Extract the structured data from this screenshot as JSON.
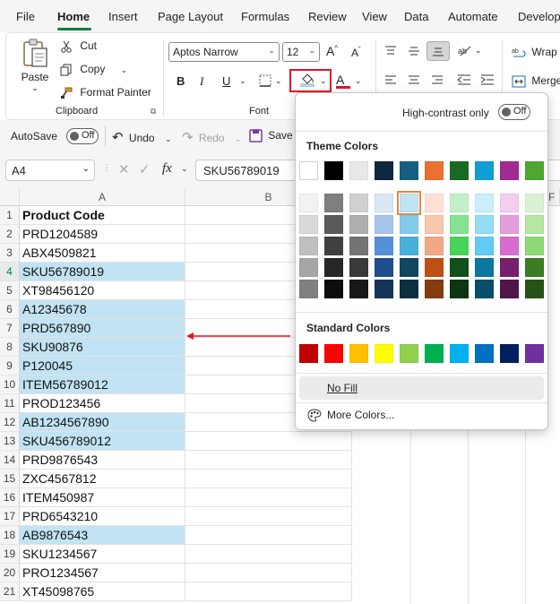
{
  "menu": {
    "tabs": [
      {
        "label": "File"
      },
      {
        "label": "Home"
      },
      {
        "label": "Insert"
      },
      {
        "label": "Page Layout"
      },
      {
        "label": "Formulas"
      },
      {
        "label": "Review"
      },
      {
        "label": "View"
      },
      {
        "label": "Data"
      },
      {
        "label": "Automate"
      },
      {
        "label": "Develop"
      }
    ],
    "active": "Home"
  },
  "ribbon": {
    "clipboard": {
      "paste": "Paste",
      "cut": "Cut",
      "copy": "Copy",
      "format_painter": "Format Painter",
      "label": "Clipboard"
    },
    "font": {
      "name": "Aptos Narrow",
      "size": "12",
      "bold": "B",
      "italic": "I",
      "underline": "U",
      "font_color_letter": "A",
      "label": "Font"
    },
    "alignment": {
      "wrap": "Wrap T",
      "merge": "Merge"
    }
  },
  "qat": {
    "autosave": "AutoSave",
    "autosave_state": "Off",
    "undo": "Undo",
    "redo": "Redo",
    "save": "Save"
  },
  "formula_bar": {
    "name_box": "A4",
    "fx": "fx",
    "value": "SKU56789019"
  },
  "grid": {
    "columns": [
      "A",
      "B",
      "F"
    ],
    "rows": [
      {
        "n": "1",
        "value": "Product Code",
        "highlight": false
      },
      {
        "n": "2",
        "value": "PRD1204589",
        "highlight": false
      },
      {
        "n": "3",
        "value": "ABX4509821",
        "highlight": false
      },
      {
        "n": "4",
        "value": "SKU56789019",
        "highlight": true
      },
      {
        "n": "5",
        "value": "XT98456120",
        "highlight": false
      },
      {
        "n": "6",
        "value": "A12345678",
        "highlight": true
      },
      {
        "n": "7",
        "value": "PRD567890",
        "highlight": true
      },
      {
        "n": "8",
        "value": "SKU90876",
        "highlight": true
      },
      {
        "n": "9",
        "value": "P120045",
        "highlight": true
      },
      {
        "n": "10",
        "value": "ITEM56789012",
        "highlight": true
      },
      {
        "n": "11",
        "value": "PROD123456",
        "highlight": false
      },
      {
        "n": "12",
        "value": "AB1234567890",
        "highlight": true
      },
      {
        "n": "13",
        "value": "SKU456789012",
        "highlight": true
      },
      {
        "n": "14",
        "value": "PRD9876543",
        "highlight": false
      },
      {
        "n": "15",
        "value": "ZXC4567812",
        "highlight": false
      },
      {
        "n": "16",
        "value": "ITEM450987",
        "highlight": false
      },
      {
        "n": "17",
        "value": "PRD6543210",
        "highlight": false
      },
      {
        "n": "18",
        "value": "AB9876543",
        "highlight": true
      },
      {
        "n": "19",
        "value": "SKU1234567",
        "highlight": false
      },
      {
        "n": "20",
        "value": "PRO1234567",
        "highlight": false
      },
      {
        "n": "21",
        "value": "XT45098765",
        "highlight": false
      }
    ],
    "highlight_color": "#c1e3f3"
  },
  "fill_dropdown": {
    "high_contrast_label": "High-contrast only",
    "high_contrast_state": "Off",
    "theme_colors_title": "Theme Colors",
    "theme_top": [
      "#ffffff",
      "#000000",
      "#e8e8e8",
      "#0e2841",
      "#156082",
      "#e97132",
      "#196b24",
      "#0f9ed5",
      "#a02b93",
      "#4ea72e"
    ],
    "theme_shades": [
      [
        "#f2f2f2",
        "#7f7f7f",
        "#d0d0d0",
        "#d9e6f5",
        "#c1e4f5",
        "#fbe2d5",
        "#c1f0c8",
        "#caeefb",
        "#f2ceef",
        "#daf2d0"
      ],
      [
        "#d9d9d9",
        "#595959",
        "#aeaeae",
        "#a6c5eb",
        "#83cbeb",
        "#f7c7ac",
        "#84e291",
        "#95dcf7",
        "#e49edd",
        "#b5e6a2"
      ],
      [
        "#bfbfbf",
        "#404040",
        "#747474",
        "#5690d9",
        "#47b0dc",
        "#f1a983",
        "#47d45a",
        "#61cbf3",
        "#d86dcd",
        "#8ed973"
      ],
      [
        "#a6a6a6",
        "#262626",
        "#3a3a3a",
        "#1f4e8c",
        "#0f4761",
        "#c04f15",
        "#124f1a",
        "#0b76a0",
        "#77206d",
        "#3b7d23"
      ],
      [
        "#808080",
        "#0d0d0d",
        "#171717",
        "#143559",
        "#0a2f41",
        "#843c0c",
        "#0c3512",
        "#074f6a",
        "#501549",
        "#275317"
      ]
    ],
    "selected_swatch": "#c1e4f5",
    "standard_colors_title": "Standard Colors",
    "standard": [
      "#c00000",
      "#ff0000",
      "#ffc000",
      "#ffff00",
      "#92d050",
      "#00b050",
      "#00b0f0",
      "#0070c0",
      "#002060",
      "#7030a0"
    ],
    "no_fill": "No Fill",
    "more_colors": "More Colors..."
  },
  "annotation_color": "#e81123"
}
